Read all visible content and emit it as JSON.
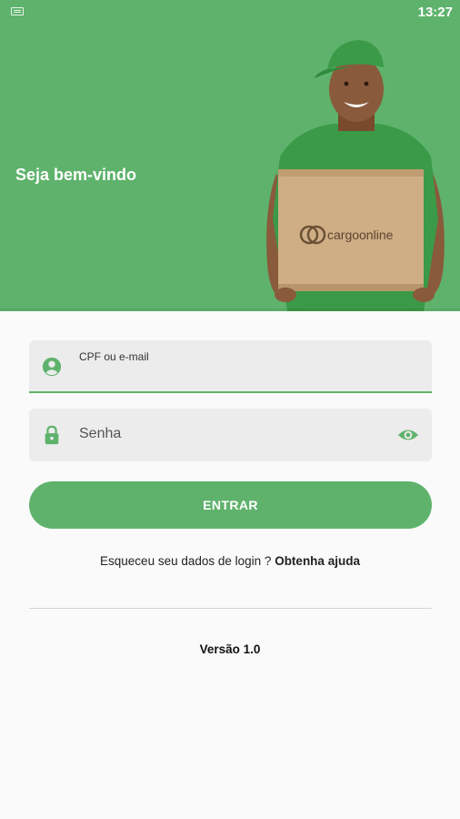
{
  "status_bar": {
    "time": "13:27"
  },
  "hero": {
    "welcome": "Seja bem-vindo",
    "box_logo": "cargoonline",
    "image": "courier-holding-box"
  },
  "form": {
    "user_label": "CPF ou e-mail",
    "password_placeholder": "Senha",
    "user_icon": "account-circle-icon",
    "password_icon": "lock-icon",
    "visibility_icon": "eye-icon",
    "submit_label": "ENTRAR"
  },
  "help": {
    "text": "Esqueceu seu dados de login ? ",
    "link": "Obtenha ajuda"
  },
  "footer": {
    "version": "Versão 1.0"
  },
  "colors": {
    "accent": "#5fb26c",
    "field_background": "#ececec",
    "page_background": "#fafafa"
  }
}
